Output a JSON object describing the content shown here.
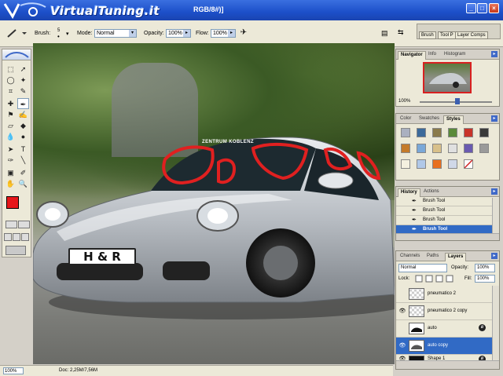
{
  "title_bar": {
    "logo_text": "VirtualTuning.it",
    "document_title": "RGB/8#)]",
    "minimize": "_",
    "maximize": "□",
    "close": "×"
  },
  "options_bar": {
    "brush_label": "Brush:",
    "brush_size": "5",
    "mode_label": "Mode:",
    "mode_value": "Normal",
    "opacity_label": "Opacity:",
    "opacity_value": "100%",
    "flow_label": "Flow:",
    "flow_value": "100%",
    "palette_well_tabs": [
      "Brush",
      "Tool P",
      "Layer Comps"
    ]
  },
  "canvas": {
    "license_plate": "H & R",
    "windshield_banner": "ZENTRUM KOBLENZ",
    "highlight_color": "#e02020"
  },
  "status_bar": {
    "zoom": "100%",
    "doc_info": "Doc: 2,25M/7,56M"
  },
  "navigator": {
    "tabs": [
      "Navigator",
      "Info",
      "Histogram"
    ],
    "zoom": "100%"
  },
  "styles_palette": {
    "tabs": [
      "Color",
      "Swatches",
      "Styles"
    ]
  },
  "history_palette": {
    "tabs": [
      "History",
      "Actions"
    ],
    "items": [
      "Brush Tool",
      "Brush Tool",
      "Brush Tool",
      "Brush Tool"
    ]
  },
  "layers_palette": {
    "tabs": [
      "Channels",
      "Paths",
      "Layers"
    ],
    "blend_mode": "Normal",
    "opacity_label": "Opacity:",
    "opacity_value": "100%",
    "lock_label": "Lock:",
    "fill_label": "Fill:",
    "fill_value": "100%",
    "layers": [
      {
        "name": "pneumatico 2"
      },
      {
        "name": "pneumatico 2 copy"
      },
      {
        "name": "auto"
      },
      {
        "name": "auto copy"
      },
      {
        "name": "Shape 1"
      }
    ]
  },
  "colors": {
    "foreground": "#e6171b",
    "background": "#ffffff",
    "selection": "#316ac5"
  }
}
